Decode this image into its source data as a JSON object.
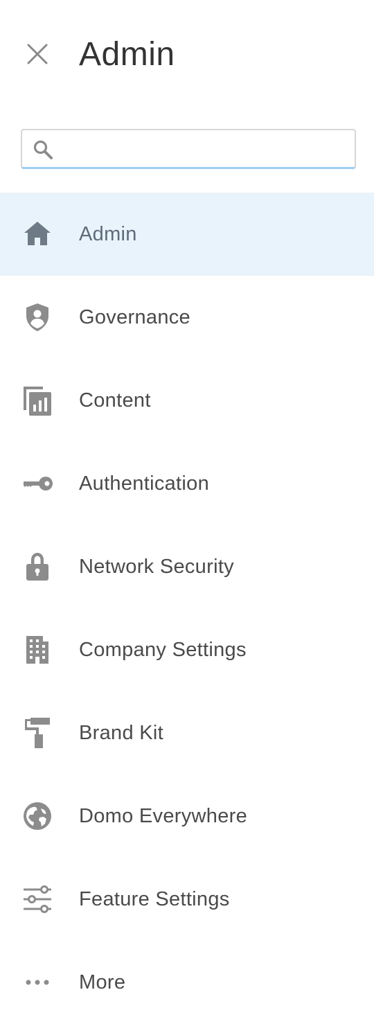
{
  "header": {
    "title": "Admin",
    "close_icon": "close-icon"
  },
  "search": {
    "placeholder": "",
    "value": "",
    "icon": "search-icon"
  },
  "nav": {
    "active_index": 0,
    "active_bg": "#e8f3fb",
    "items": [
      {
        "label": "Admin",
        "icon": "home-icon"
      },
      {
        "label": "Governance",
        "icon": "shield-user-icon"
      },
      {
        "label": "Content",
        "icon": "content-report-icon"
      },
      {
        "label": "Authentication",
        "icon": "key-icon"
      },
      {
        "label": "Network Security",
        "icon": "lock-icon"
      },
      {
        "label": "Company Settings",
        "icon": "building-icon"
      },
      {
        "label": "Brand Kit",
        "icon": "paint-roller-icon"
      },
      {
        "label": "Domo Everywhere",
        "icon": "globe-icon"
      },
      {
        "label": "Feature Settings",
        "icon": "sliders-icon"
      },
      {
        "label": "More",
        "icon": "more-dots-icon"
      }
    ]
  }
}
